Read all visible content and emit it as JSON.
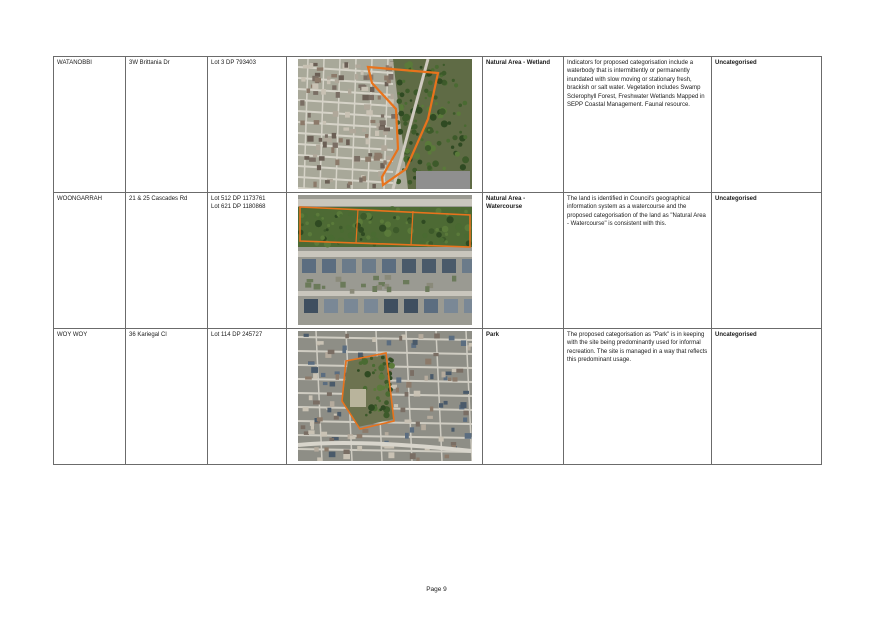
{
  "rows": [
    {
      "locality": "WATANOBBI",
      "address": "3W Brittania Dr",
      "lots": [
        "Lot 3 DP 793403"
      ],
      "category": "Natural Area - Wetland",
      "reason": "Indicators for proposed categorisation include a waterbody that is intermittently or permanently inundated with slow moving or stationary fresh, brackish or salt water. Vegetation includes Swamp Sclerophyll Forest, Freshwater Wetlands Mapped in SEPP Coastal Management. Faunal resource.",
      "status": "Uncategorised",
      "image": "aerial-photo-wetland"
    },
    {
      "locality": "WOONGARRAH",
      "address": "21 & 25 Cascades Rd",
      "lots": [
        "Lot 512 DP 1173761",
        "Lot 621 DP 1180868"
      ],
      "category": "Natural Area - Watercourse",
      "reason": "The land is identified in Council's geographical information system as a watercourse and the proposed categorisation of the land as \"Natural Area - Watercourse\" is consistent with this.",
      "status": "Uncategorised",
      "image": "aerial-photo-watercourse"
    },
    {
      "locality": "WOY WOY",
      "address": "36 Kariegal Cl",
      "lots": [
        "Lot 114 DP 245727"
      ],
      "category": "Park",
      "reason": "The proposed categorisation as \"Park\" is in keeping with the site being predominantly used for informal recreation. The site is managed in a way that reflects this predominant usage.",
      "status": "Uncategorised",
      "image": "aerial-photo-park"
    }
  ],
  "footer": {
    "page_label": "Page 9"
  },
  "colors": {
    "boundary": "#e8731c",
    "border": "#6b6b6b"
  }
}
